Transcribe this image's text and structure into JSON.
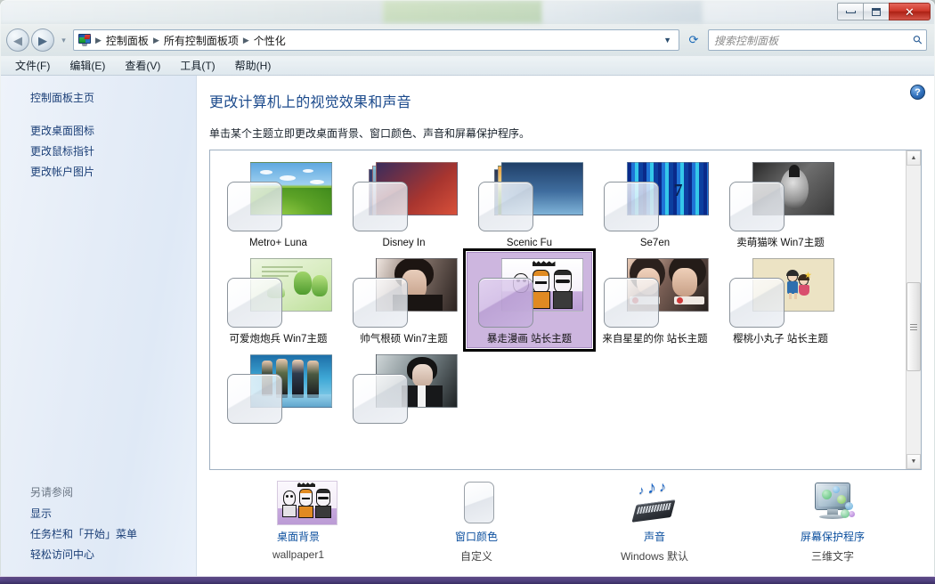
{
  "window": {
    "controls": {
      "minimize": "最小化",
      "maximize": "最大化",
      "close": "关闭"
    }
  },
  "navbar": {
    "back_label": "后退",
    "forward_label": "前进",
    "history_label": "最近浏览的位置",
    "breadcrumb": [
      "控制面板",
      "所有控制面板项",
      "个性化"
    ],
    "refresh_label": "刷新",
    "search_placeholder": "搜索控制面板",
    "search_value": ""
  },
  "menubar": {
    "items": [
      "文件(F)",
      "编辑(E)",
      "查看(V)",
      "工具(T)",
      "帮助(H)"
    ]
  },
  "navpane": {
    "home": "控制面板主页",
    "links": [
      "更改桌面图标",
      "更改鼠标指针",
      "更改帐户图片"
    ],
    "see_also_title": "另请参阅",
    "see_also": [
      "显示",
      "任务栏和「开始」菜单",
      "轻松访问中心"
    ]
  },
  "content": {
    "help_label": "帮助",
    "title": "更改计算机上的视觉效果和声音",
    "subtitle": "单击某个主题立即更改桌面背景、窗口颜色、声音和屏幕保护程序。"
  },
  "themes": [
    {
      "label": "Metro+ Luna",
      "art": "bliss",
      "stacked": false,
      "selected": false
    },
    {
      "label": "Disney In",
      "art": "disney",
      "stacked": true,
      "selected": false
    },
    {
      "label": "Scenic Fu",
      "art": "scenic",
      "stacked": true,
      "selected": false
    },
    {
      "label": "Se7en",
      "art": "se7en",
      "stacked": false,
      "selected": false
    },
    {
      "label": "卖萌猫咪 Win7主题",
      "art": "cat",
      "stacked": false,
      "selected": false
    },
    {
      "label": "可爱炮炮兵 Win7主题",
      "art": "green",
      "stacked": false,
      "selected": false
    },
    {
      "label": "帅气根硕 Win7主题",
      "art": "idol",
      "stacked": false,
      "selected": false
    },
    {
      "label": "暴走漫画 站长主题",
      "art": "baozou",
      "stacked": false,
      "selected": true
    },
    {
      "label": "来自星星的你 站长主题",
      "art": "star",
      "stacked": false,
      "selected": false
    },
    {
      "label": "樱桃小丸子 站长主题",
      "art": "maruko",
      "stacked": false,
      "selected": false
    },
    {
      "label": "",
      "art": "game",
      "stacked": false,
      "selected": false
    },
    {
      "label": "",
      "art": "man",
      "stacked": false,
      "selected": false
    }
  ],
  "scrollbar": {
    "up": "向上滚动",
    "down": "向下滚动",
    "thumb": "滚动滑块"
  },
  "settings": [
    {
      "icon": "desktop-background-icon",
      "label": "桌面背景",
      "value": "wallpaper1"
    },
    {
      "icon": "window-color-icon",
      "label": "窗口颜色",
      "value": "自定义"
    },
    {
      "icon": "sound-icon",
      "label": "声音",
      "value": "Windows 默认"
    },
    {
      "icon": "screensaver-icon",
      "label": "屏幕保护程序",
      "value": "三维文字"
    }
  ],
  "colors": {
    "link": "#0b4f9e",
    "title": "#1b4a8c",
    "selection_fill": "#cdb6df",
    "selection_outline": "#000000"
  }
}
